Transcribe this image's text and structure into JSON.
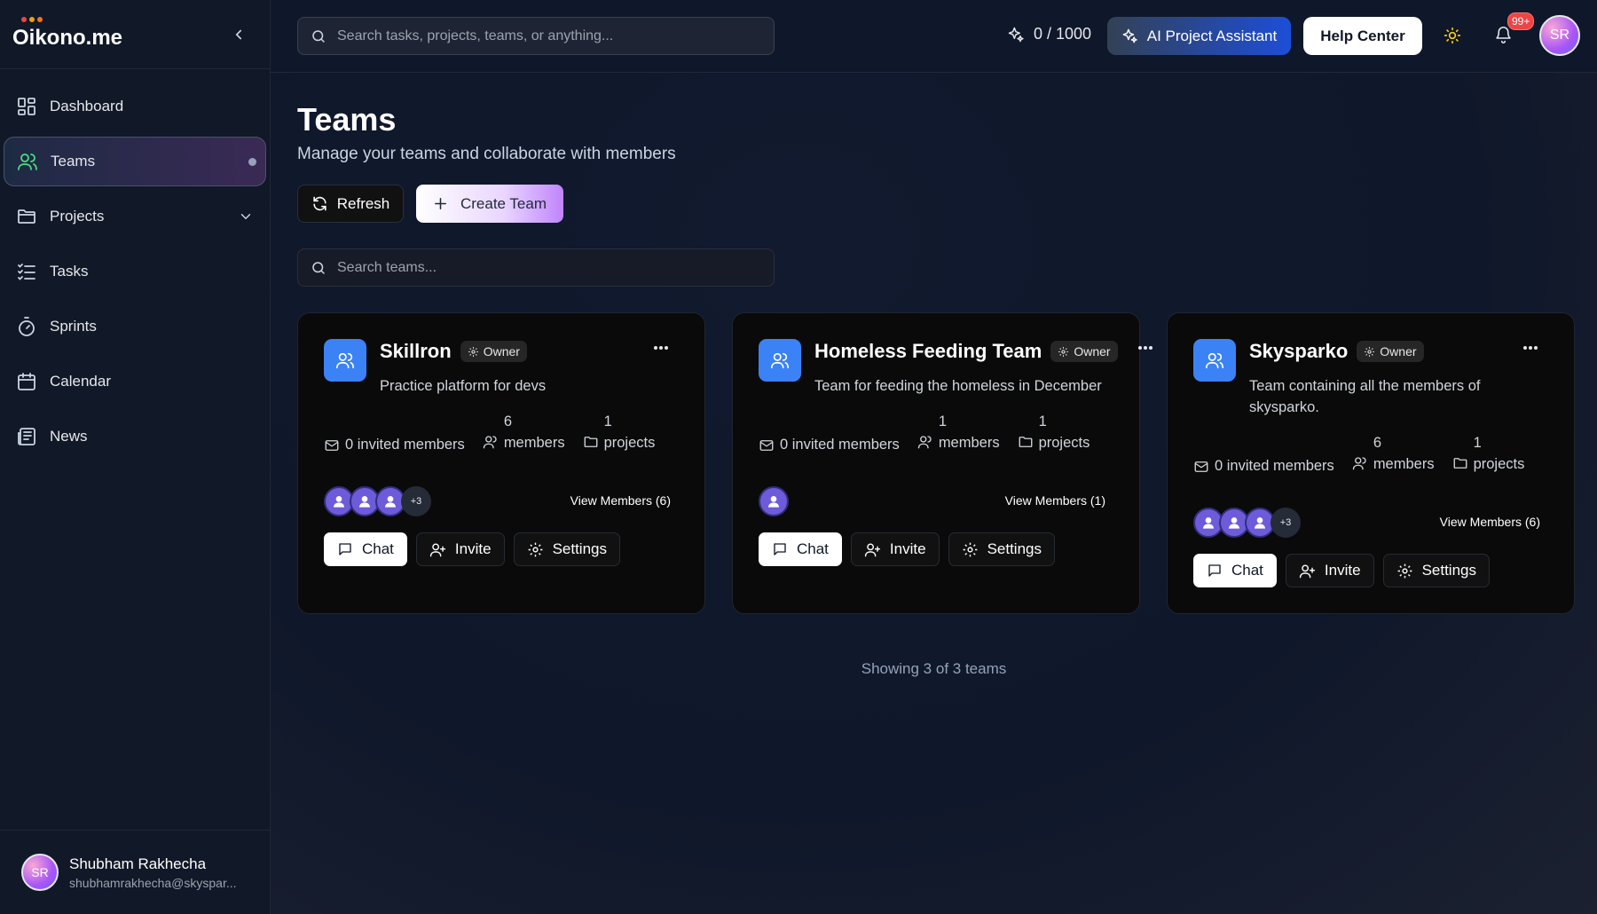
{
  "app": {
    "brand": "Oikono.me",
    "brand_dot_colors": [
      "#ef4444",
      "#f59e0b",
      "#f97316"
    ]
  },
  "sidebar": {
    "items": [
      {
        "label": "Dashboard",
        "icon": "dashboard-icon",
        "active": false
      },
      {
        "label": "Teams",
        "icon": "users-icon",
        "active": true
      },
      {
        "label": "Projects",
        "icon": "folder-icon",
        "active": false,
        "expandable": true
      },
      {
        "label": "Tasks",
        "icon": "list-icon",
        "active": false
      },
      {
        "label": "Sprints",
        "icon": "timer-icon",
        "active": false
      },
      {
        "label": "Calendar",
        "icon": "calendar-icon",
        "active": false
      },
      {
        "label": "News",
        "icon": "newspaper-icon",
        "active": false
      }
    ],
    "user": {
      "initials": "SR",
      "name": "Shubham Rakhecha",
      "email": "shubhamrakhecha@skyspar..."
    }
  },
  "topbar": {
    "search_placeholder": "Search tasks, projects, teams, or anything...",
    "credits": "0 / 1000",
    "ai_button": "AI Project Assistant",
    "help_button": "Help Center",
    "notification_badge": "99+",
    "avatar_initials": "SR"
  },
  "page": {
    "title": "Teams",
    "subtitle": "Manage your teams and collaborate with members",
    "refresh_label": "Refresh",
    "create_label": "Create Team",
    "team_search_placeholder": "Search teams...",
    "footer": "Showing 3 of 3 teams"
  },
  "teams": [
    {
      "name": "Skillron",
      "role": "Owner",
      "description": "Practice platform for devs",
      "invited": "0 invited members",
      "members_count": "6",
      "members_label": "members",
      "projects_count": "1",
      "projects_label": "projects",
      "extra_avatars": "+3",
      "view_members": "View Members (6)",
      "chat": "Chat",
      "invite": "Invite",
      "settings": "Settings"
    },
    {
      "name": "Homeless Feeding Team",
      "role": "Owner",
      "description": "Team for feeding the homeless in December",
      "invited": "0 invited members",
      "members_count": "1",
      "members_label": "members",
      "projects_count": "1",
      "projects_label": "projects",
      "extra_avatars": "",
      "view_members": "View Members (1)",
      "chat": "Chat",
      "invite": "Invite",
      "settings": "Settings"
    },
    {
      "name": "Skysparko",
      "role": "Owner",
      "description": "Team containing all the members of skysparko.",
      "invited": "0 invited members",
      "members_count": "6",
      "members_label": "members",
      "projects_count": "1",
      "projects_label": "projects",
      "extra_avatars": "+3",
      "view_members": "View Members (6)",
      "chat": "Chat",
      "invite": "Invite",
      "settings": "Settings"
    }
  ]
}
